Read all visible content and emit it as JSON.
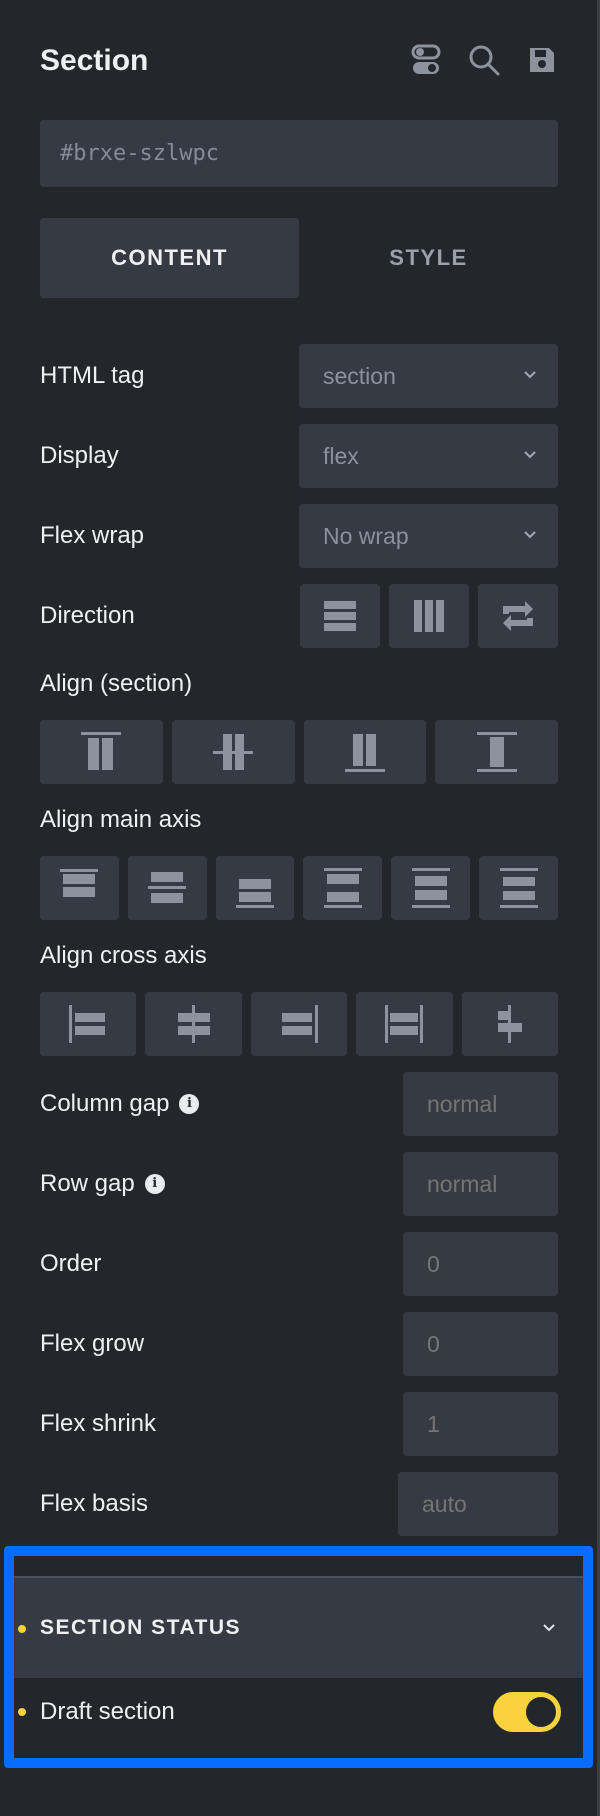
{
  "header": {
    "title": "Section",
    "icons": [
      "toggle-icon",
      "search-icon",
      "save-icon"
    ]
  },
  "id_field": {
    "value": "#brxe-szlwpc"
  },
  "tabs": [
    {
      "label": "CONTENT",
      "active": true
    },
    {
      "label": "STYLE",
      "active": false
    }
  ],
  "fields": {
    "html_tag": {
      "label": "HTML tag",
      "value": "section"
    },
    "display": {
      "label": "Display",
      "value": "flex"
    },
    "flex_wrap": {
      "label": "Flex wrap",
      "value": "No wrap"
    },
    "direction": {
      "label": "Direction",
      "options": [
        "column-icon",
        "row-icon",
        "reverse-icon"
      ]
    },
    "align_section": {
      "label": "Align (section)",
      "options": [
        "align-top-icon",
        "align-center-icon",
        "align-bottom-icon",
        "align-stretch-icon"
      ]
    },
    "align_main": {
      "label": "Align main axis",
      "options": [
        "justify-start-icon",
        "justify-center-icon",
        "justify-end-icon",
        "justify-between-icon",
        "justify-around-icon",
        "justify-evenly-icon"
      ]
    },
    "align_cross": {
      "label": "Align cross axis",
      "options": [
        "align-start-icon",
        "align-center-icon",
        "align-end-icon",
        "align-stretch-icon",
        "align-baseline-icon"
      ]
    },
    "column_gap": {
      "label": "Column gap",
      "placeholder": "normal"
    },
    "row_gap": {
      "label": "Row gap",
      "placeholder": "normal"
    },
    "order": {
      "label": "Order",
      "placeholder": "0"
    },
    "flex_grow": {
      "label": "Flex grow",
      "placeholder": "0"
    },
    "flex_shrink": {
      "label": "Flex shrink",
      "placeholder": "1"
    },
    "flex_basis": {
      "label": "Flex basis",
      "placeholder": "auto"
    }
  },
  "section_status": {
    "title": "SECTION STATUS",
    "draft_label": "Draft section",
    "draft_enabled": true
  },
  "colors": {
    "background": "#23272c",
    "control": "#363b43",
    "accent": "#f8cf3f",
    "highlight": "#0a6cff"
  }
}
